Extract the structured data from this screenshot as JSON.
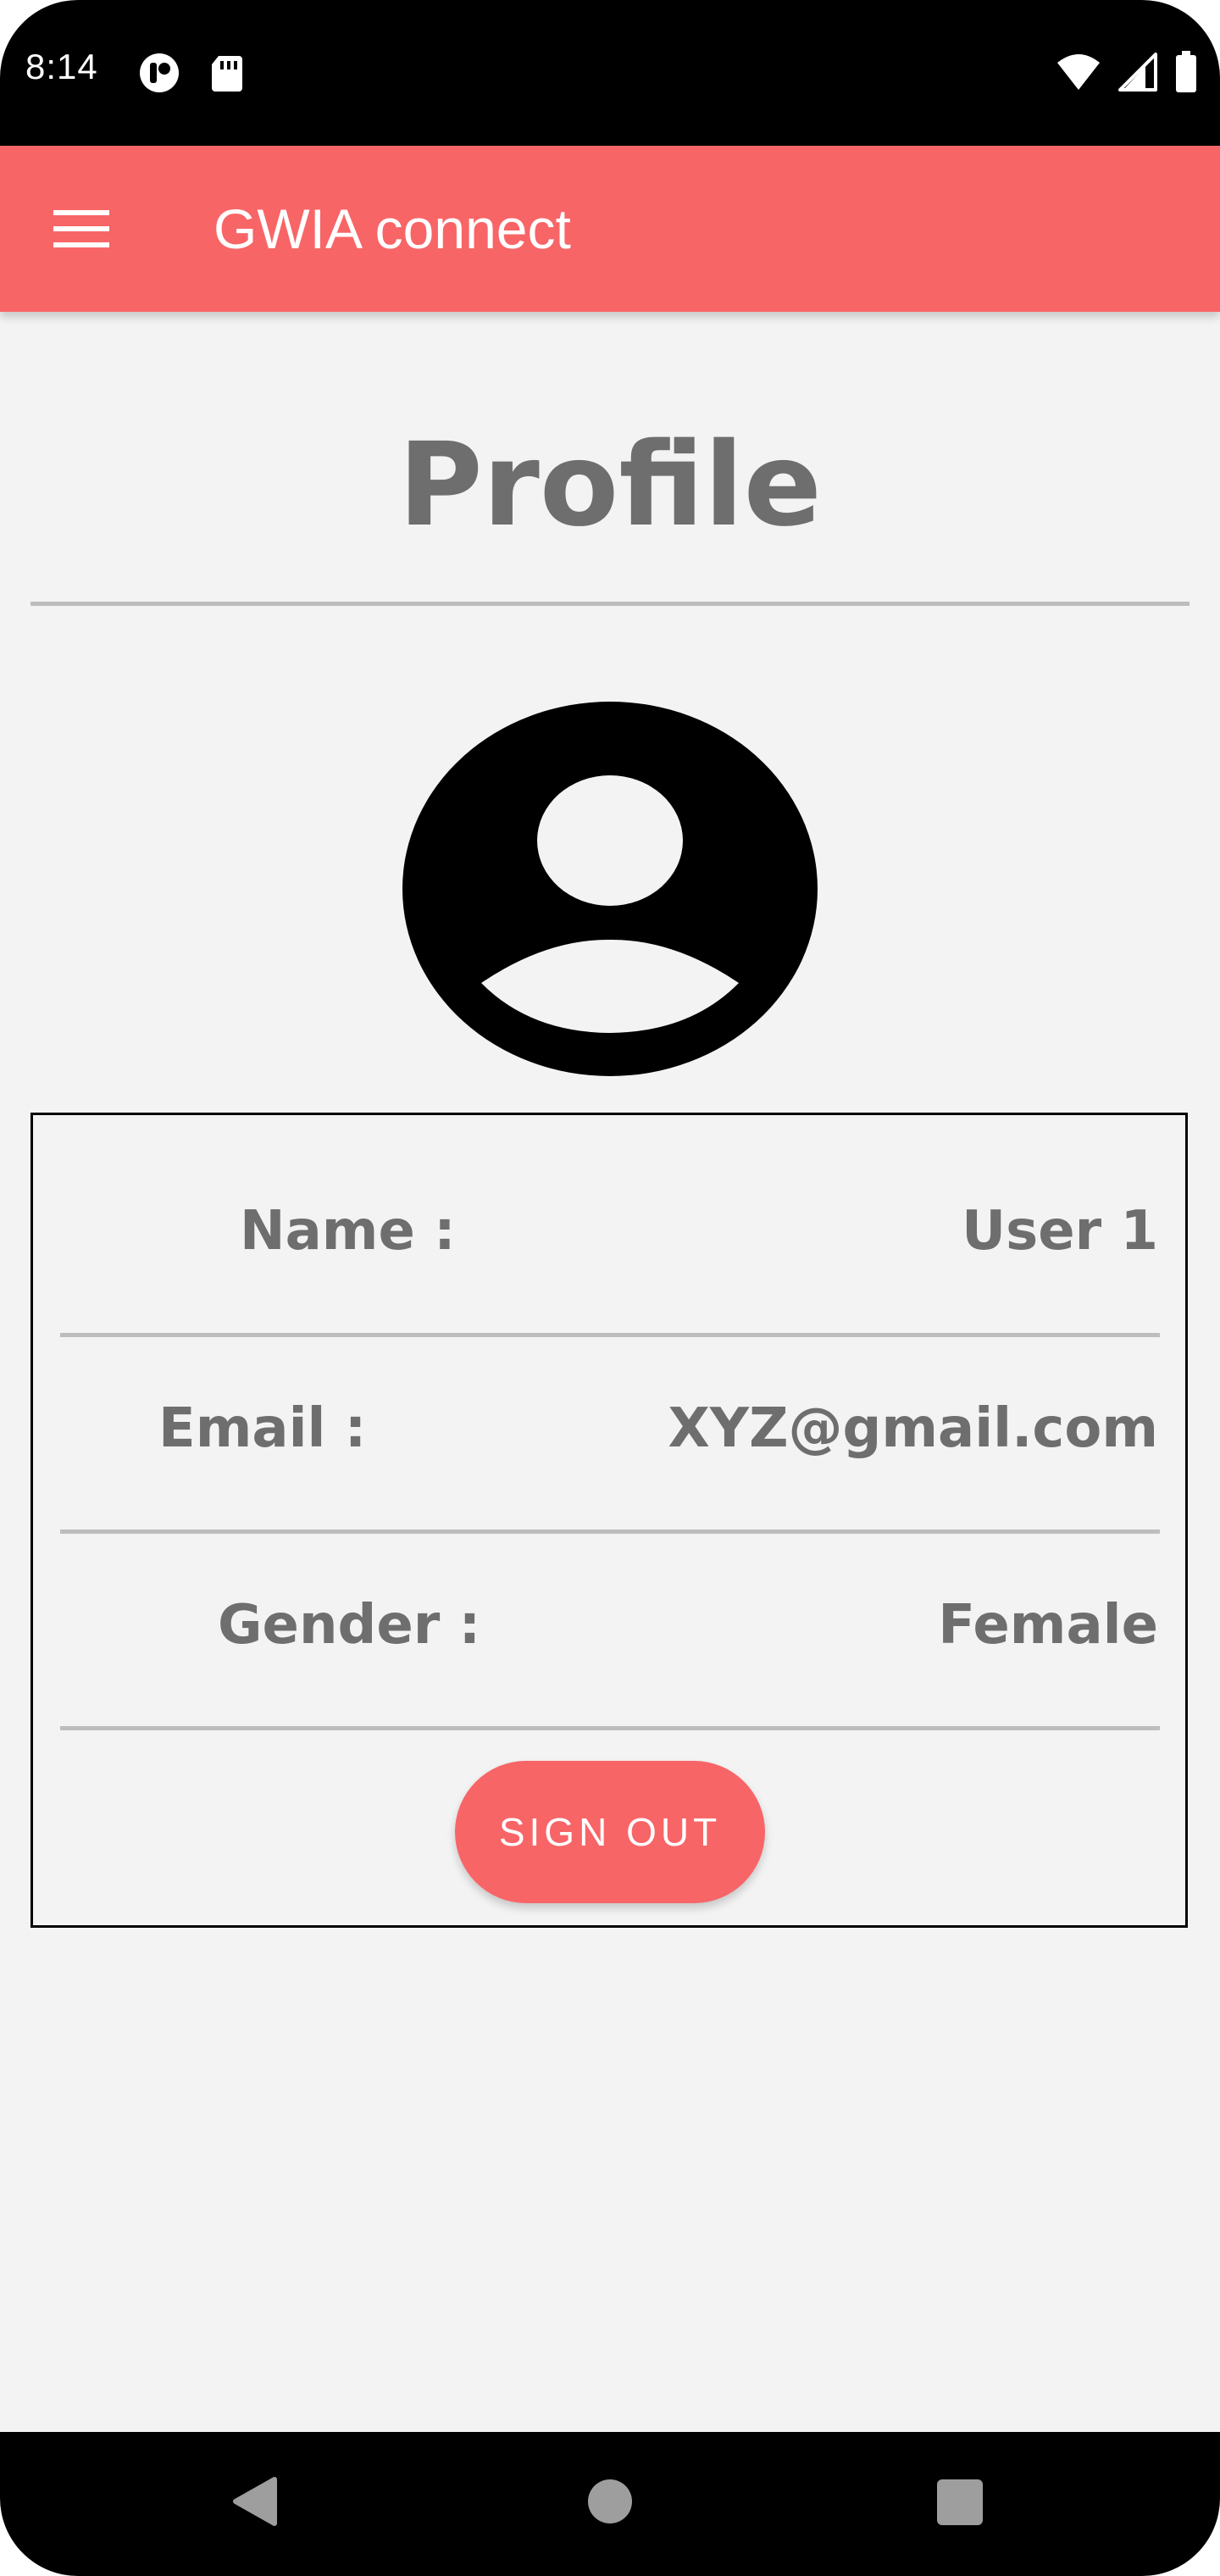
{
  "status_bar": {
    "time": "8:14",
    "left_icons": [
      "notification-app-icon",
      "sd-card-icon"
    ],
    "right_icons": [
      "wifi-icon",
      "cellular-signal-icon",
      "battery-icon"
    ]
  },
  "app_bar": {
    "menu_icon": "hamburger-menu-icon",
    "title": "GWIA connect",
    "background_color": "#f86567"
  },
  "page": {
    "title": "Profile",
    "avatar_icon": "account-circle-icon"
  },
  "profile": {
    "rows": [
      {
        "label": "Name :",
        "value": "User 1"
      },
      {
        "label": "Email :",
        "value": "XYZ@gmail.com"
      },
      {
        "label": "Gender :",
        "value": "Female"
      }
    ],
    "sign_out_label": "SIGN OUT"
  },
  "nav_bar": {
    "icons": [
      "back-triangle-icon",
      "home-circle-icon",
      "recents-square-icon"
    ]
  },
  "colors": {
    "accent": "#f86567",
    "text_gray": "#6e6e6e",
    "divider": "#bdbdbd",
    "background": "#f3f3f3"
  }
}
